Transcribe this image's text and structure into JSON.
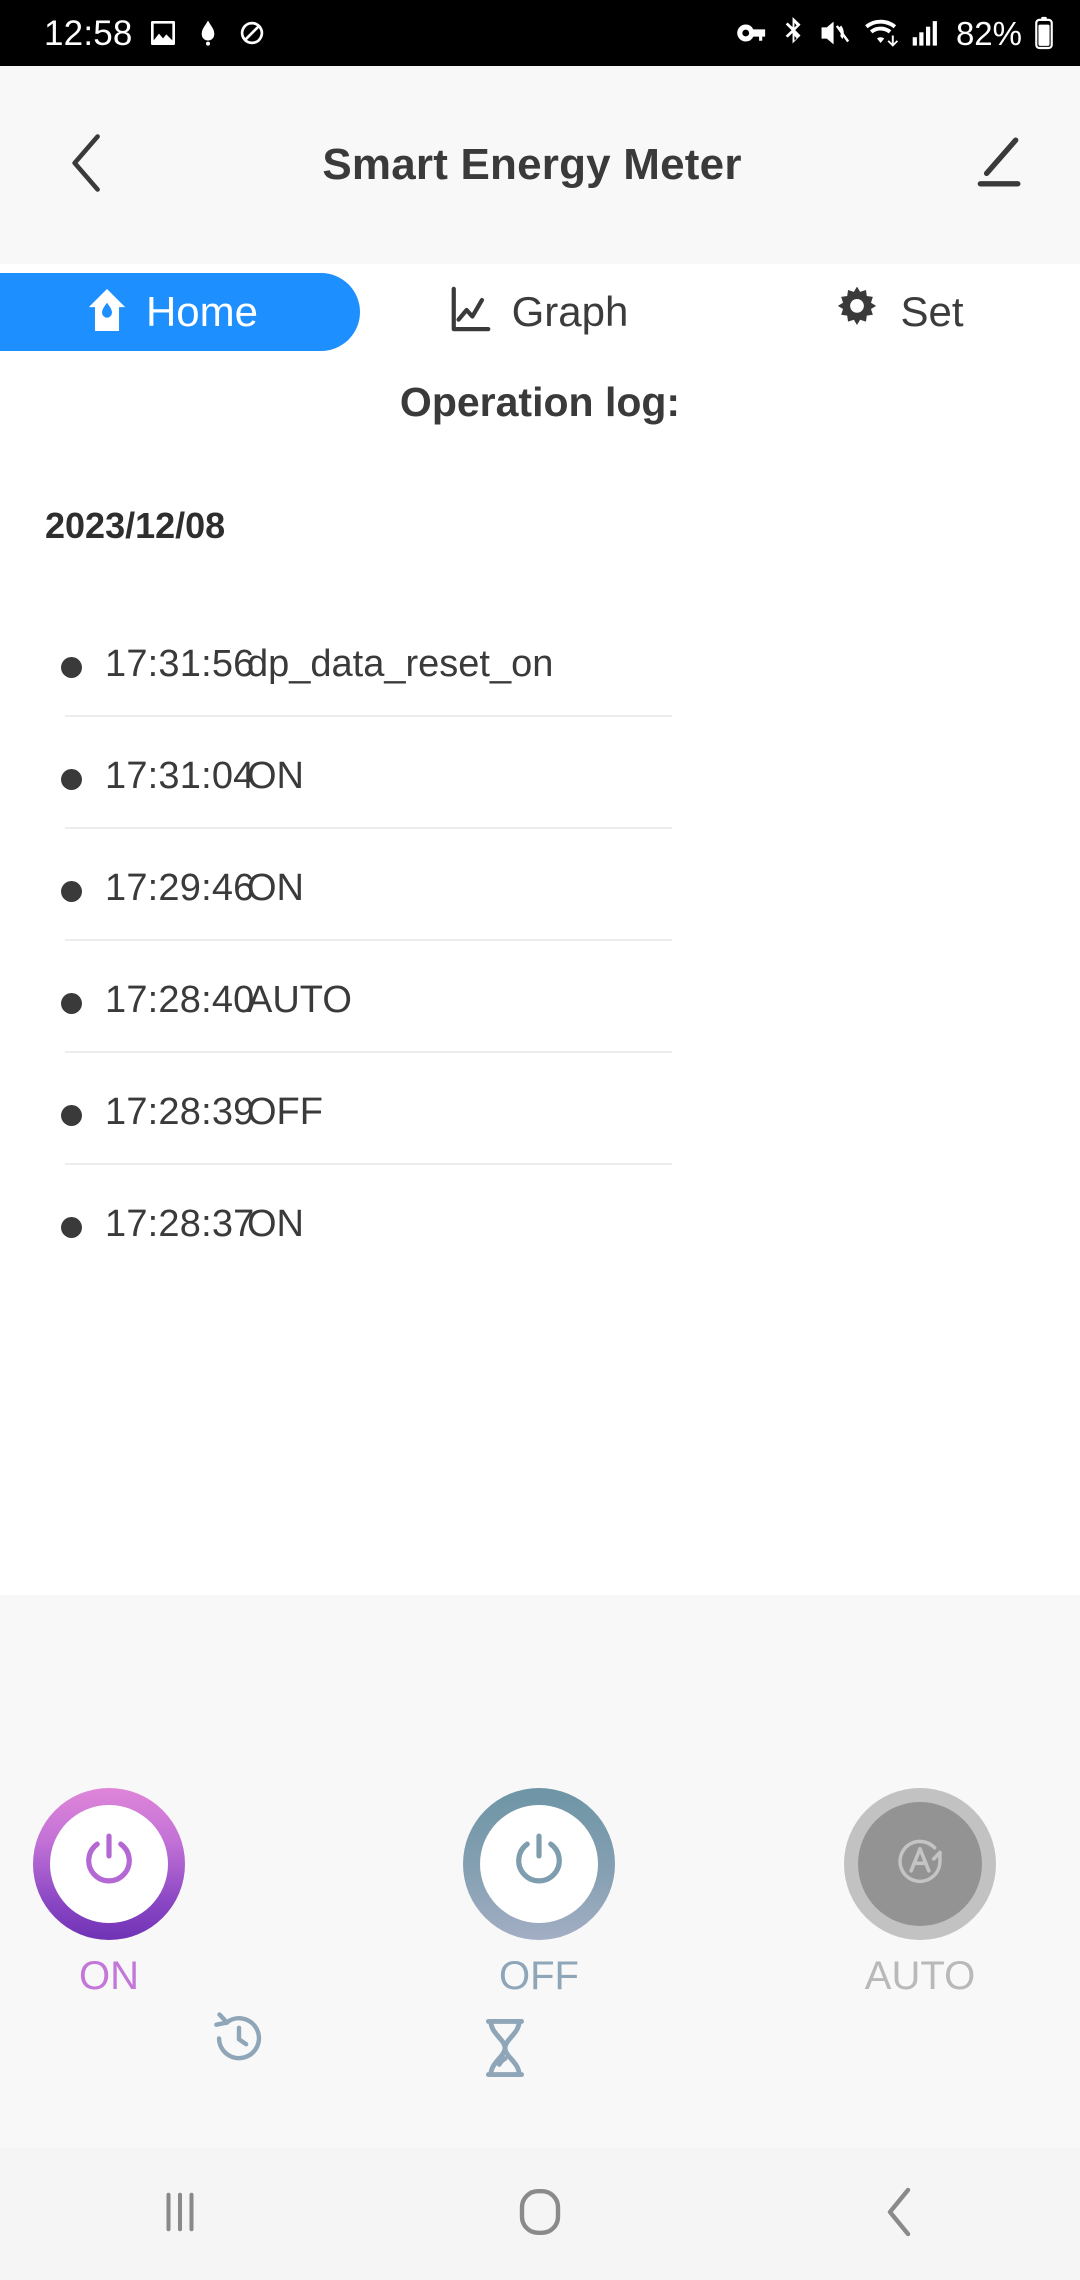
{
  "status_bar": {
    "time": "12:58",
    "battery_percent": "82%",
    "left_icons": [
      "image-icon",
      "app-badge-icon",
      "no-notification-icon"
    ],
    "right_icons": [
      "key-icon",
      "bluetooth-icon",
      "mute-icon",
      "wifi-icon",
      "cellular-signal-icon",
      "battery-icon"
    ]
  },
  "app_bar": {
    "back_icon": "back-chevron-icon",
    "title": "Smart Energy Meter",
    "edit_icon": "pencil-edit-icon"
  },
  "tabs": [
    {
      "label": "Home",
      "icon": "home-icon",
      "active": true
    },
    {
      "label": "Graph",
      "icon": "graph-icon",
      "active": false
    },
    {
      "label": "Set",
      "icon": "gear-icon",
      "active": false
    }
  ],
  "log": {
    "title": "Operation log:",
    "date": "2023/12/08",
    "entries": [
      {
        "time": "17:31:56",
        "event": "dp_data_reset_on"
      },
      {
        "time": "17:31:04",
        "event": "ON"
      },
      {
        "time": "17:29:46",
        "event": "ON"
      },
      {
        "time": "17:28:40",
        "event": "AUTO"
      },
      {
        "time": "17:28:39",
        "event": "OFF"
      },
      {
        "time": "17:28:37",
        "event": "ON"
      }
    ]
  },
  "controls": {
    "on": {
      "label": "ON",
      "icon": "power-icon",
      "color": "#c277d9"
    },
    "off": {
      "label": "OFF",
      "icon": "power-icon",
      "color": "#8fa6b8"
    },
    "auto": {
      "label": "AUTO",
      "icon": "auto-a-icon",
      "color": "#b9b9b9"
    },
    "extra_icons": [
      {
        "name": "timer-history-icon",
        "color": "#8fa6b8"
      },
      {
        "name": "hourglass-icon",
        "color": "#8fa6b8"
      }
    ]
  },
  "nav_bar": {
    "items": [
      {
        "icon": "recents-icon"
      },
      {
        "icon": "home-square-icon"
      },
      {
        "icon": "back-chevron-icon"
      }
    ]
  },
  "colors": {
    "accent_blue": "#1e8fff",
    "header_bg": "#f8f8f9",
    "panel_bg": "#f8f8f8",
    "text_dark": "#3a3a3a"
  }
}
